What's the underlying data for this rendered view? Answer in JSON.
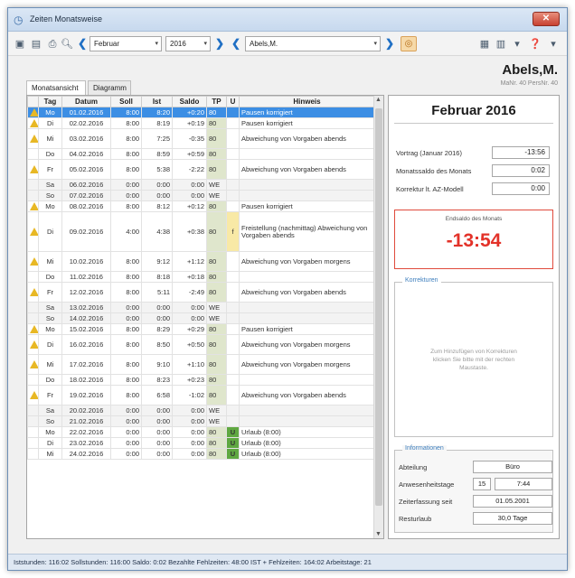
{
  "window": {
    "title": "Zeiten Monatsweise",
    "close_label": "✕"
  },
  "toolbar": {
    "month": "Februar",
    "year": "2016",
    "person": "Abels,M."
  },
  "person": {
    "name": "Abels,M.",
    "meta": "MaNr. 40  PersNr. 40"
  },
  "tabs": [
    "Monatsansicht",
    "Diagramm"
  ],
  "table": {
    "headers": [
      "Tag",
      "Datum",
      "Soll",
      "Ist",
      "Saldo",
      "TP",
      "U",
      "Hinweis"
    ],
    "rows": [
      {
        "warn": true,
        "tag": "Mo",
        "datum": "01.02.2016",
        "soll": "8:00",
        "ist": "8:20",
        "saldo": "+0:20",
        "tp": "80",
        "u": "",
        "hinweis": "Pausen korrigiert",
        "selected": true
      },
      {
        "warn": true,
        "tag": "Di",
        "datum": "02.02.2016",
        "soll": "8:00",
        "ist": "8:19",
        "saldo": "+0:19",
        "tp": "80",
        "u": "",
        "hinweis": "Pausen korrigiert"
      },
      {
        "warn": true,
        "tag": "Mi",
        "datum": "03.02.2016",
        "soll": "8:00",
        "ist": "7:25",
        "saldo": "-0:35",
        "tp": "80",
        "u": "",
        "hinweis": "Abweichung von Vorgaben abends"
      },
      {
        "warn": false,
        "tag": "Do",
        "datum": "04.02.2016",
        "soll": "8:00",
        "ist": "8:59",
        "saldo": "+0:59",
        "tp": "80",
        "u": "",
        "hinweis": ""
      },
      {
        "warn": true,
        "tag": "Fr",
        "datum": "05.02.2016",
        "soll": "8:00",
        "ist": "5:38",
        "saldo": "-2:22",
        "tp": "80",
        "u": "",
        "hinweis": "Abweichung von Vorgaben abends"
      },
      {
        "warn": false,
        "tag": "Sa",
        "datum": "06.02.2016",
        "soll": "0:00",
        "ist": "0:00",
        "saldo": "0:00",
        "tp": "WE",
        "u": "",
        "hinweis": "",
        "weekend": true
      },
      {
        "warn": false,
        "tag": "So",
        "datum": "07.02.2016",
        "soll": "0:00",
        "ist": "0:00",
        "saldo": "0:00",
        "tp": "WE",
        "u": "",
        "hinweis": "",
        "weekend": true
      },
      {
        "warn": true,
        "tag": "Mo",
        "datum": "08.02.2016",
        "soll": "8:00",
        "ist": "8:12",
        "saldo": "+0:12",
        "tp": "80",
        "u": "",
        "hinweis": "Pausen korrigiert"
      },
      {
        "warn": true,
        "tag": "Di",
        "datum": "09.02.2016",
        "soll": "4:00",
        "ist": "4:38",
        "saldo": "+0:38",
        "tp": "80",
        "u": "f",
        "hinweis": "Freistellung (nachmittag) Abweichung von Vorgaben abends",
        "tall": true
      },
      {
        "warn": true,
        "tag": "Mi",
        "datum": "10.02.2016",
        "soll": "8:00",
        "ist": "9:12",
        "saldo": "+1:12",
        "tp": "80",
        "u": "",
        "hinweis": "Abweichung von Vorgaben morgens"
      },
      {
        "warn": false,
        "tag": "Do",
        "datum": "11.02.2016",
        "soll": "8:00",
        "ist": "8:18",
        "saldo": "+0:18",
        "tp": "80",
        "u": "",
        "hinweis": ""
      },
      {
        "warn": true,
        "tag": "Fr",
        "datum": "12.02.2016",
        "soll": "8:00",
        "ist": "5:11",
        "saldo": "-2:49",
        "tp": "80",
        "u": "",
        "hinweis": "Abweichung von Vorgaben abends"
      },
      {
        "warn": false,
        "tag": "Sa",
        "datum": "13.02.2016",
        "soll": "0:00",
        "ist": "0:00",
        "saldo": "0:00",
        "tp": "WE",
        "u": "",
        "hinweis": "",
        "weekend": true
      },
      {
        "warn": false,
        "tag": "So",
        "datum": "14.02.2016",
        "soll": "0:00",
        "ist": "0:00",
        "saldo": "0:00",
        "tp": "WE",
        "u": "",
        "hinweis": "",
        "weekend": true
      },
      {
        "warn": true,
        "tag": "Mo",
        "datum": "15.02.2016",
        "soll": "8:00",
        "ist": "8:29",
        "saldo": "+0:29",
        "tp": "80",
        "u": "",
        "hinweis": "Pausen korrigiert"
      },
      {
        "warn": true,
        "tag": "Di",
        "datum": "16.02.2016",
        "soll": "8:00",
        "ist": "8:50",
        "saldo": "+0:50",
        "tp": "80",
        "u": "",
        "hinweis": "Abweichung von Vorgaben morgens"
      },
      {
        "warn": true,
        "tag": "Mi",
        "datum": "17.02.2016",
        "soll": "8:00",
        "ist": "9:10",
        "saldo": "+1:10",
        "tp": "80",
        "u": "",
        "hinweis": "Abweichung von Vorgaben morgens"
      },
      {
        "warn": false,
        "tag": "Do",
        "datum": "18.02.2016",
        "soll": "8:00",
        "ist": "8:23",
        "saldo": "+0:23",
        "tp": "80",
        "u": "",
        "hinweis": ""
      },
      {
        "warn": true,
        "tag": "Fr",
        "datum": "19.02.2016",
        "soll": "8:00",
        "ist": "6:58",
        "saldo": "-1:02",
        "tp": "80",
        "u": "",
        "hinweis": "Abweichung von Vorgaben abends"
      },
      {
        "warn": false,
        "tag": "Sa",
        "datum": "20.02.2016",
        "soll": "0:00",
        "ist": "0:00",
        "saldo": "0:00",
        "tp": "WE",
        "u": "",
        "hinweis": "",
        "weekend": true
      },
      {
        "warn": false,
        "tag": "So",
        "datum": "21.02.2016",
        "soll": "0:00",
        "ist": "0:00",
        "saldo": "0:00",
        "tp": "WE",
        "u": "",
        "hinweis": "",
        "weekend": true
      },
      {
        "warn": false,
        "tag": "Mo",
        "datum": "22.02.2016",
        "soll": "0:00",
        "ist": "0:00",
        "saldo": "0:00",
        "tp": "80",
        "u": "U",
        "hinweis": "Urlaub (8:00)"
      },
      {
        "warn": false,
        "tag": "Di",
        "datum": "23.02.2016",
        "soll": "0:00",
        "ist": "0:00",
        "saldo": "0:00",
        "tp": "80",
        "u": "U",
        "hinweis": "Urlaub (8:00)"
      },
      {
        "warn": false,
        "tag": "Mi",
        "datum": "24.02.2016",
        "soll": "0:00",
        "ist": "0:00",
        "saldo": "0:00",
        "tp": "80",
        "u": "U",
        "hinweis": "Urlaub (8:00)"
      }
    ]
  },
  "summary": {
    "month_title": "Februar 2016",
    "vortrag_label": "Vortrag (Januar 2016)",
    "vortrag_value": "-13:56",
    "monatssaldo_label": "Monatssaldo des Monats",
    "monatssaldo_value": "0:02",
    "korrektur_label": "Korrektur lt. AZ-Modell",
    "korrektur_value": "0:00",
    "endsaldo_label": "Endsaldo des Monats",
    "endsaldo_value": "-13:54",
    "korrekturen_title": "Korrekturen",
    "korrekturen_placeholder": "Zum Hinzufügen von Korrekturen klicken Sie bitte mit der rechten Maustaste.",
    "info_title": "Informationen",
    "abteilung_label": "Abteilung",
    "abteilung_value": "Büro",
    "anwesenheit_label": "Anwesenheitstage",
    "anwesenheit_days": "15",
    "anwesenheit_time": "7:44",
    "zeiterfassung_label": "Zeiterfassung seit",
    "zeiterfassung_value": "01.05.2001",
    "resturlaub_label": "Resturlaub",
    "resturlaub_value": "30,0 Tage"
  },
  "statusbar": "Iststunden: 116:02  Sollstunden: 116:00  Saldo: 0:02  Bezahlte Fehlzeiten: 48:00  IST + Fehlzeiten: 164:02  Arbeitstage: 21",
  "colors": {
    "accent": "#3c8ee4",
    "endsaldo": "#e33229",
    "positive": "#2a8e2a",
    "negative": "#d0342c"
  }
}
